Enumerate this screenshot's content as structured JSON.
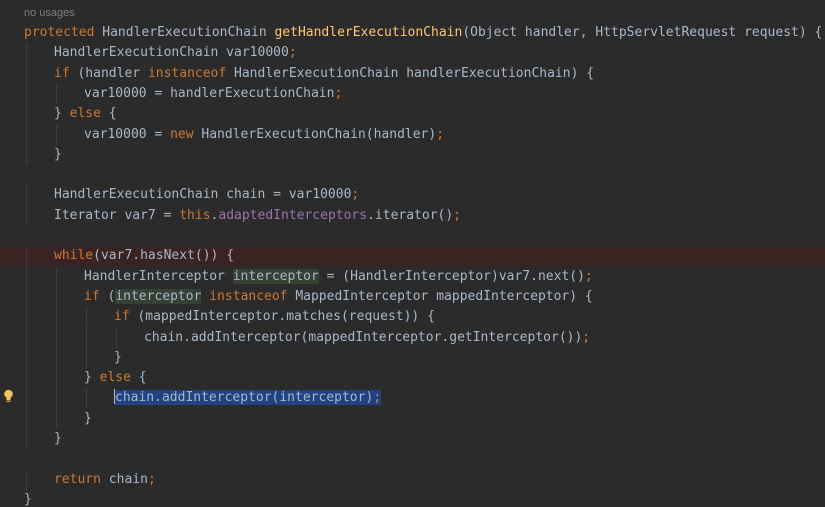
{
  "editor": {
    "usage_hint": "no usages",
    "gutter_icon": "lightbulb-icon",
    "lines": [
      {
        "t": [
          [
            "kw",
            "protected "
          ],
          [
            "",
            "HandlerExecutionChain "
          ],
          [
            "fn",
            "getHandlerExecutionChain"
          ],
          [
            "",
            "(Object handler, HttpServletRequest request) {"
          ]
        ]
      },
      {
        "t": [
          [
            "",
            "HandlerExecutionChain var10000"
          ],
          [
            "kw",
            ";"
          ]
        ]
      },
      {
        "t": [
          [
            "kw",
            "if "
          ],
          [
            "",
            "(handler "
          ],
          [
            "kw",
            "instanceof "
          ],
          [
            "",
            "HandlerExecutionChain handlerExecutionChain) {"
          ]
        ]
      },
      {
        "t": [
          [
            "",
            "var10000 = handlerExecutionChain"
          ],
          [
            "kw",
            ";"
          ]
        ]
      },
      {
        "t": [
          [
            "",
            "} "
          ],
          [
            "kw",
            "else "
          ],
          [
            "",
            "{"
          ]
        ]
      },
      {
        "t": [
          [
            "",
            "var10000 = "
          ],
          [
            "kw",
            "new "
          ],
          [
            "",
            "HandlerExecutionChain(handler)"
          ],
          [
            "kw",
            ";"
          ]
        ]
      },
      {
        "t": [
          [
            "",
            "}"
          ]
        ]
      },
      {
        "t": []
      },
      {
        "t": [
          [
            "",
            "HandlerExecutionChain chain = var10000"
          ],
          [
            "kw",
            ";"
          ]
        ]
      },
      {
        "t": [
          [
            "",
            "Iterator var7 = "
          ],
          [
            "kw",
            "this"
          ],
          [
            "",
            "."
          ],
          [
            "fld",
            "adaptedInterceptors"
          ],
          [
            "",
            ".iterator()"
          ],
          [
            "kw",
            ";"
          ]
        ]
      },
      {
        "t": []
      },
      {
        "t": [
          [
            "kw",
            "while"
          ],
          [
            "",
            "(var7.hasNext()) {"
          ]
        ]
      },
      {
        "t": [
          [
            "",
            "HandlerInterceptor "
          ],
          [
            "ref",
            "interceptor"
          ],
          [
            "",
            " = (HandlerInterceptor)var7.next()"
          ],
          [
            "kw",
            ";"
          ]
        ]
      },
      {
        "t": [
          [
            "kw",
            "if "
          ],
          [
            "",
            "("
          ],
          [
            "ref",
            "interceptor"
          ],
          [
            "kw",
            " instanceof "
          ],
          [
            "",
            "MappedInterceptor mappedInterceptor) {"
          ]
        ]
      },
      {
        "t": [
          [
            "kw",
            "if "
          ],
          [
            "",
            "(mappedInterceptor.matches(request)) {"
          ]
        ]
      },
      {
        "t": [
          [
            "",
            "chain.addInterceptor(mappedInterceptor.getInterceptor())"
          ],
          [
            "kw",
            ";"
          ]
        ]
      },
      {
        "t": [
          [
            "",
            "}"
          ]
        ]
      },
      {
        "t": [
          [
            "",
            "} "
          ],
          [
            "kw",
            "else "
          ],
          [
            "",
            "{"
          ]
        ]
      },
      {
        "t": [
          [
            "caret",
            ""
          ],
          [
            "sel",
            "chain.addInterceptor(interceptor)"
          ],
          [
            "selkw",
            ";"
          ]
        ]
      },
      {
        "t": [
          [
            "",
            "}"
          ]
        ]
      },
      {
        "t": [
          [
            "",
            "}"
          ]
        ]
      },
      {
        "t": []
      },
      {
        "t": [
          [
            "kw",
            "return "
          ],
          [
            "",
            "chain"
          ],
          [
            "kw",
            ";"
          ]
        ]
      },
      {
        "t": [
          [
            "",
            "}"
          ]
        ]
      }
    ]
  }
}
